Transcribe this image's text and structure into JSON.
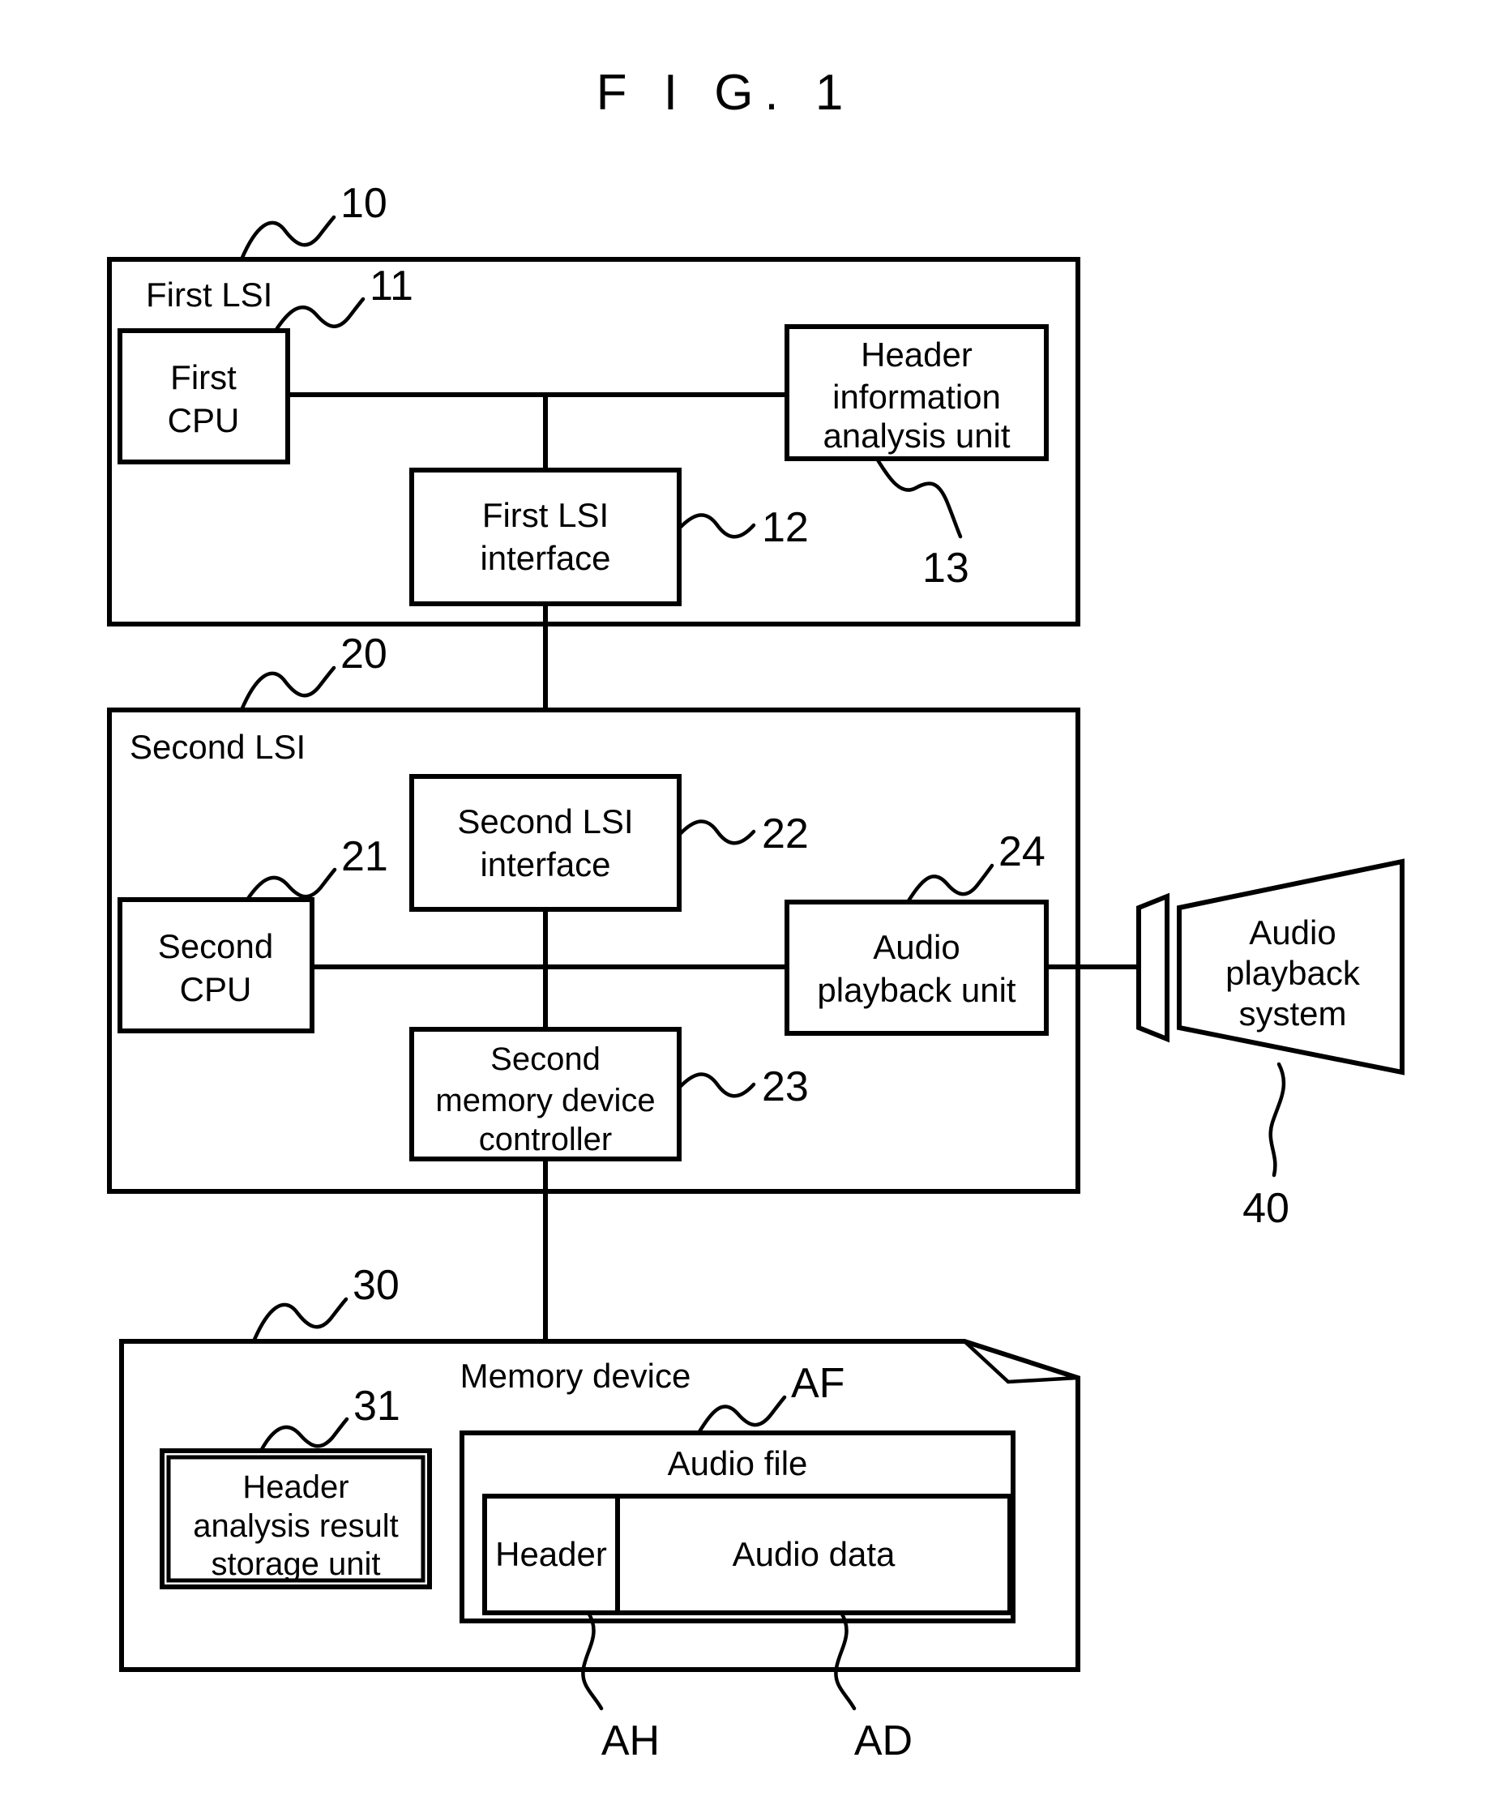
{
  "figure": {
    "title": "F I G. 1",
    "type": "patent-block-diagram"
  },
  "blocks": {
    "first_lsi": {
      "label": "First LSI",
      "ref": "10",
      "children": {
        "first_cpu": {
          "line1": "First",
          "line2": "CPU",
          "ref": "11"
        },
        "first_lsi_interface": {
          "line1": "First LSI",
          "line2": "interface",
          "ref": "12"
        },
        "header_info_analysis_unit": {
          "line1": "Header",
          "line2": "information",
          "line3": "analysis unit",
          "ref": "13"
        }
      }
    },
    "second_lsi": {
      "label": "Second LSI",
      "ref": "20",
      "children": {
        "second_cpu": {
          "line1": "Second",
          "line2": "CPU",
          "ref": "21"
        },
        "second_lsi_interface": {
          "line1": "Second LSI",
          "line2": "interface",
          "ref": "22"
        },
        "second_memory_device_controller": {
          "line1": "Second",
          "line2": "memory device",
          "line3": "controller",
          "ref": "23"
        },
        "audio_playback_unit": {
          "line1": "Audio",
          "line2": "playback unit",
          "ref": "24"
        }
      }
    },
    "audio_playback_system": {
      "line1": "Audio",
      "line2": "playback",
      "line3": "system",
      "ref": "40"
    },
    "memory_device": {
      "label": "Memory device",
      "ref": "30",
      "children": {
        "header_analysis_result_storage_unit": {
          "line1": "Header",
          "line2": "analysis result",
          "line3": "storage unit",
          "ref": "31"
        },
        "audio_file": {
          "label": "Audio file",
          "ref": "AF",
          "parts": [
            {
              "label": "Header",
              "ref": "AH"
            },
            {
              "label": "Audio data",
              "ref": "AD"
            }
          ]
        }
      }
    }
  },
  "colors": {
    "ink": "#000000",
    "paper": "#ffffff"
  }
}
